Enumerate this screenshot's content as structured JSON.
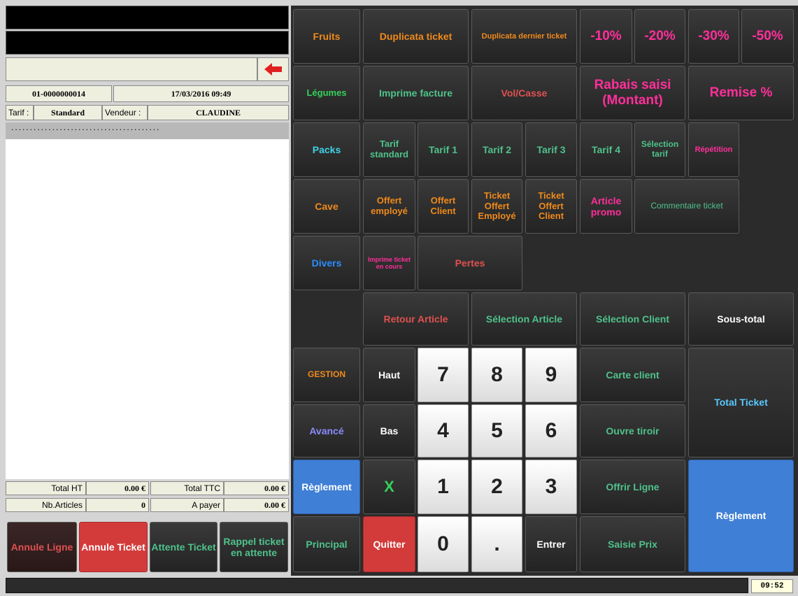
{
  "left": {
    "ticket_number": "01-0000000014",
    "datetime": "17/03/2016 09:49",
    "tarif_label": "Tarif :",
    "tarif_value": "Standard",
    "vendeur_label": "Vendeur :",
    "vendeur_value": "CLAUDINE",
    "dotted": "........................................",
    "totals": {
      "total_ht_label": "Total HT",
      "total_ht_value": "0.00 €",
      "total_ttc_label": "Total TTC",
      "total_ttc_value": "0.00 €",
      "nb_articles_label": "Nb.Articles",
      "nb_articles_value": "0",
      "a_payer_label": "A payer",
      "a_payer_value": "0.00 €"
    },
    "bottom_buttons": {
      "annule_ligne": "Annule Ligne",
      "annule_ticket": "Annule Ticket",
      "attente_ticket": "Attente Ticket",
      "rappel_ticket": "Rappel ticket en attente"
    }
  },
  "categories": {
    "fruits": "Fruits",
    "legumes": "Légumes",
    "packs": "Packs",
    "cave": "Cave",
    "divers": "Divers",
    "gestion": "GESTION",
    "avance": "Avancé",
    "reglement": "Règlement",
    "principal": "Principal"
  },
  "functions": {
    "duplicata_ticket": "Duplicata ticket",
    "duplicata_dernier": "Duplicata dernier ticket",
    "minus10": "-10%",
    "minus20": "-20%",
    "minus30": "-30%",
    "minus50": "-50%",
    "imprime_facture": "Imprime facture",
    "vol_casse": "Vol/Casse",
    "rabais_saisi": "Rabais saisi (Montant)",
    "remise": "Remise %",
    "tarif_standard": "Tarif standard",
    "tarif1": "Tarif 1",
    "tarif2": "Tarif 2",
    "tarif3": "Tarif 3",
    "tarif4": "Tarif 4",
    "selection_tarif": "Sélection tarif",
    "repetition": "Répétition",
    "offert_employe": "Offert employé",
    "offert_client": "Offert Client",
    "ticket_offert_employe": "Ticket Offert Employé",
    "ticket_offert_client": "Ticket Offert Client",
    "article_promo": "Article promo",
    "commentaire_ticket": "Commentaire ticket",
    "imprime_ticket_en_cours": "Imprime ticket en cours",
    "pertes": "Pertes",
    "retour_article": "Retour Article",
    "selection_article": "Sélection Article",
    "selection_client": "Sélection Client",
    "sous_total": "Sous-total",
    "carte_client": "Carte client",
    "total_ticket": "Total Ticket",
    "ouvre_tiroir": "Ouvre tiroir",
    "offrir_ligne": "Offrir Ligne",
    "reglement": "Règlement",
    "saisie_prix": "Saisie Prix"
  },
  "keypad": {
    "haut": "Haut",
    "bas": "Bas",
    "x": "X",
    "quitter": "Quitter",
    "k7": "7",
    "k8": "8",
    "k9": "9",
    "k4": "4",
    "k5": "5",
    "k6": "6",
    "k1": "1",
    "k2": "2",
    "k3": "3",
    "k0": "0",
    "dot": ".",
    "entrer": "Entrer"
  },
  "status": {
    "clock": "09:52"
  },
  "icons": {
    "back": "left-arrow-icon"
  }
}
